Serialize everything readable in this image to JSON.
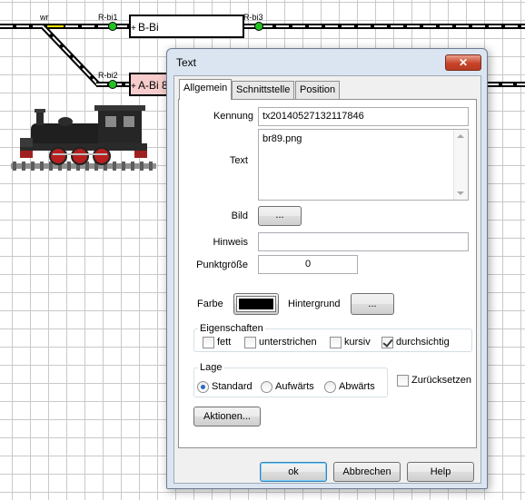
{
  "track": {
    "labels": {
      "switch": "wr",
      "sensor_bi1": "R-bi1",
      "sensor_bi2": "R-bi2",
      "sensor_bi3": "R-bi3"
    },
    "blocks": {
      "b_bi": "B-Bi",
      "a_bi": "A-Bi 8"
    },
    "plus": "+",
    "loco_image_icon": "steam-locomotive-br89"
  },
  "dialog": {
    "title": "Text",
    "close_glyph": "✕",
    "tabs": [
      "Allgemein",
      "Schnittstelle",
      "Position"
    ],
    "active_tab": "Allgemein",
    "general": {
      "kennung_label": "Kennung",
      "kennung_value": "tx20140527132117846",
      "text_label": "Text",
      "text_value": "br89.png",
      "bild_label": "Bild",
      "bild_button": "...",
      "hinweis_label": "Hinweis",
      "hinweis_value": "",
      "punktgroesse_label": "Punktgröße",
      "punktgroesse_value": "0",
      "farbe_label": "Farbe",
      "farbe_color": "#000000",
      "hintergrund_label": "Hintergrund",
      "hintergrund_button": "...",
      "eigenschaften": {
        "legend": "Eigenschaften",
        "fett": "fett",
        "unterstrichen": "unterstrichen",
        "kursiv": "kursiv",
        "durchsichtig": "durchsichtig",
        "checked": [
          "durchsichtig"
        ]
      },
      "lage": {
        "legend": "Lage",
        "standard": "Standard",
        "aufwaerts": "Aufwärts",
        "abwaerts": "Abwärts",
        "selected": "Standard"
      },
      "zuruecksetzen": "Zurücksetzen",
      "aktionen_button": "Aktionen..."
    },
    "footer": {
      "ok": "ok",
      "abbrechen": "Abbrechen",
      "hilfe": "Help"
    }
  },
  "colors": {
    "track": "#000000",
    "sensor_on": "#22c222",
    "switch_marker": "#f2e600",
    "occupied_block": "#f6cccc",
    "dialog_frame": "#dbe5f1",
    "close_button": "#c7432a"
  }
}
